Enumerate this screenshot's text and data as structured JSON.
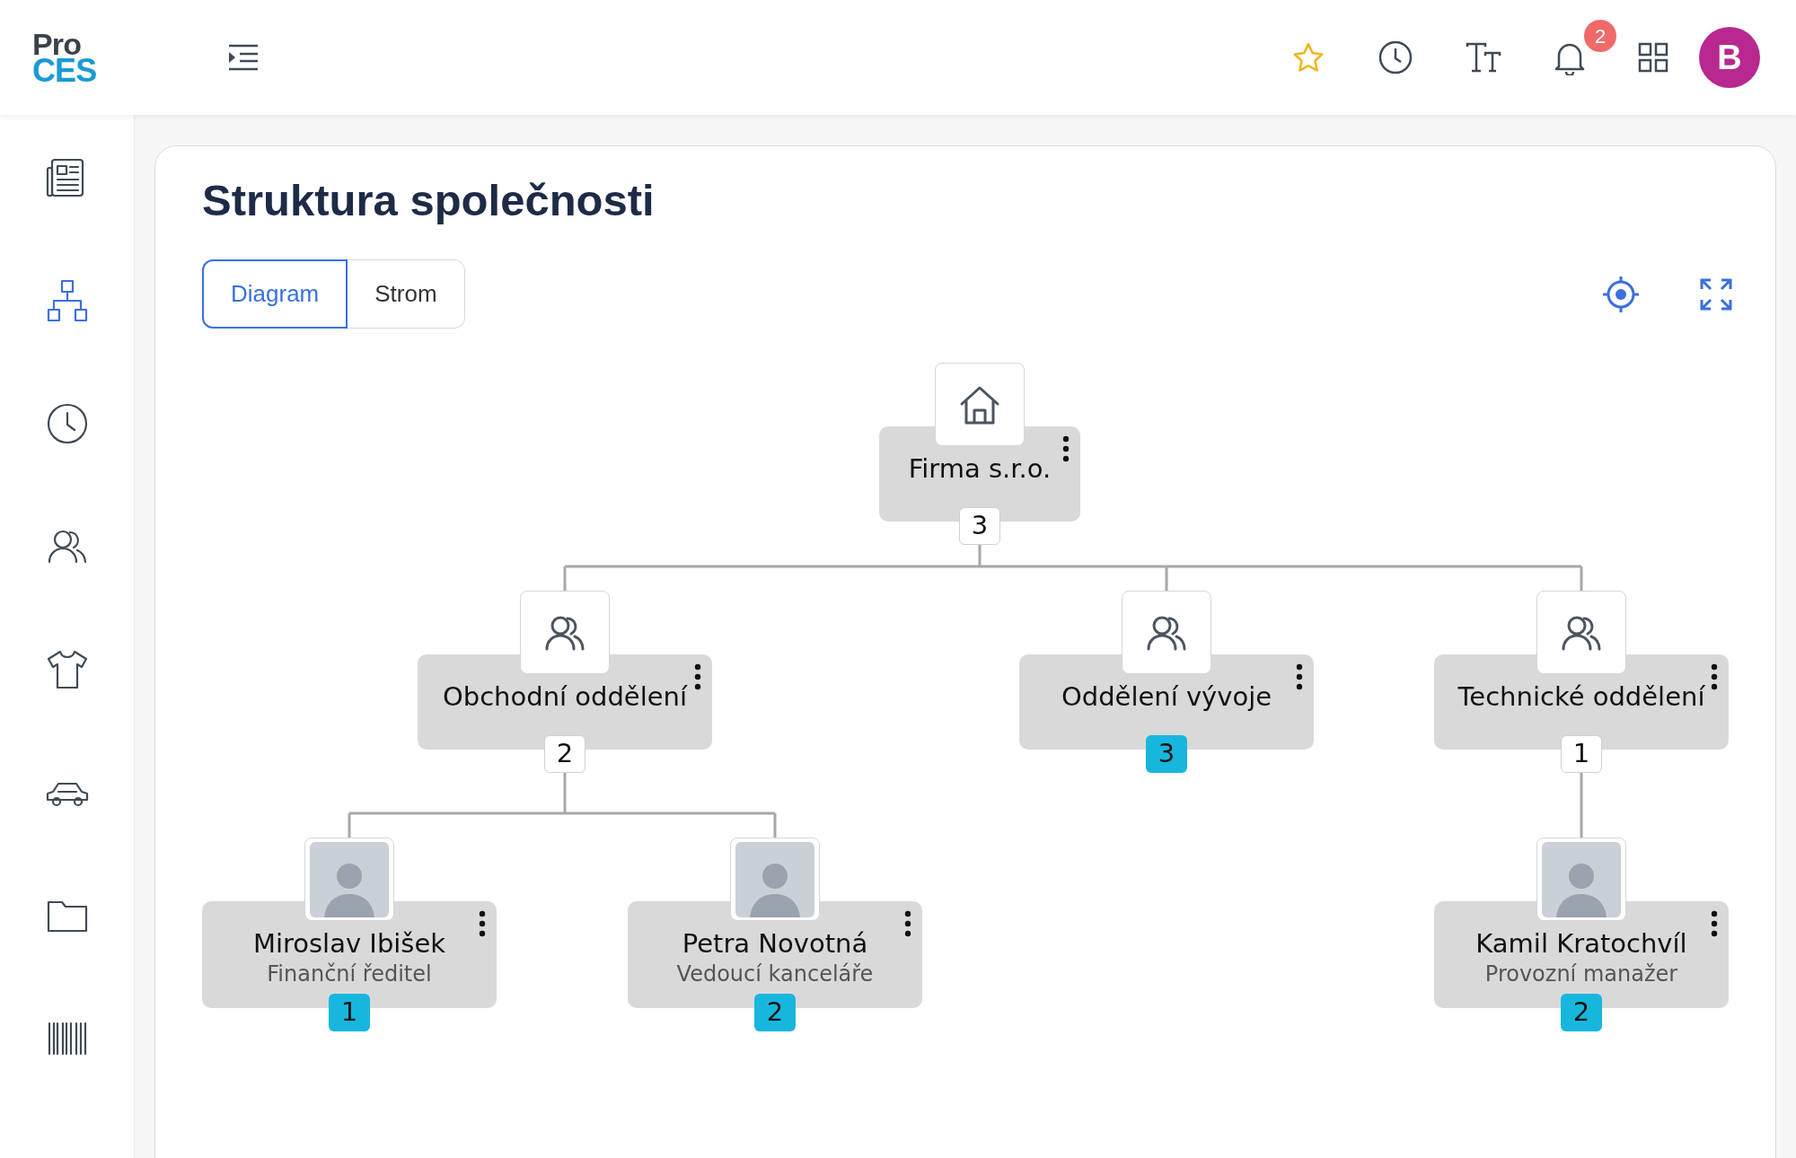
{
  "header": {
    "logo_top": "Pro",
    "logo_bottom": "CES",
    "notifications": "2",
    "avatar": "B"
  },
  "sidebar": {
    "items": [
      {
        "selected": false
      },
      {
        "selected": true
      },
      {
        "selected": false
      },
      {
        "selected": false
      },
      {
        "selected": false
      },
      {
        "selected": false
      },
      {
        "selected": false
      },
      {
        "selected": false
      }
    ]
  },
  "page": {
    "title": "Struktura společnosti",
    "tabs": [
      {
        "label": "Diagram",
        "selected": true
      },
      {
        "label": "Strom",
        "selected": false
      }
    ]
  },
  "org": {
    "kind": "company",
    "name": "Firma s.r.o.",
    "count": "3",
    "count_filled": false,
    "children": [
      {
        "kind": "department",
        "name": "Obchodní oddělení",
        "count": "2",
        "count_filled": false,
        "children": [
          {
            "kind": "person",
            "name": "Miroslav Ibišek",
            "role": "Finanční ředitel",
            "count": "1",
            "count_filled": true
          },
          {
            "kind": "person",
            "name": "Petra Novotná",
            "role": "Vedoucí kanceláře",
            "count": "2",
            "count_filled": true
          }
        ]
      },
      {
        "kind": "department",
        "name": "Oddělení vývoje",
        "count": "3",
        "count_filled": true
      },
      {
        "kind": "department",
        "name": "Technické oddělení",
        "count": "1",
        "count_filled": false,
        "children": [
          {
            "kind": "person",
            "name": "Kamil Kratochvíl",
            "role": "Provozní manažer",
            "count": "2",
            "count_filled": true
          }
        ]
      }
    ]
  }
}
